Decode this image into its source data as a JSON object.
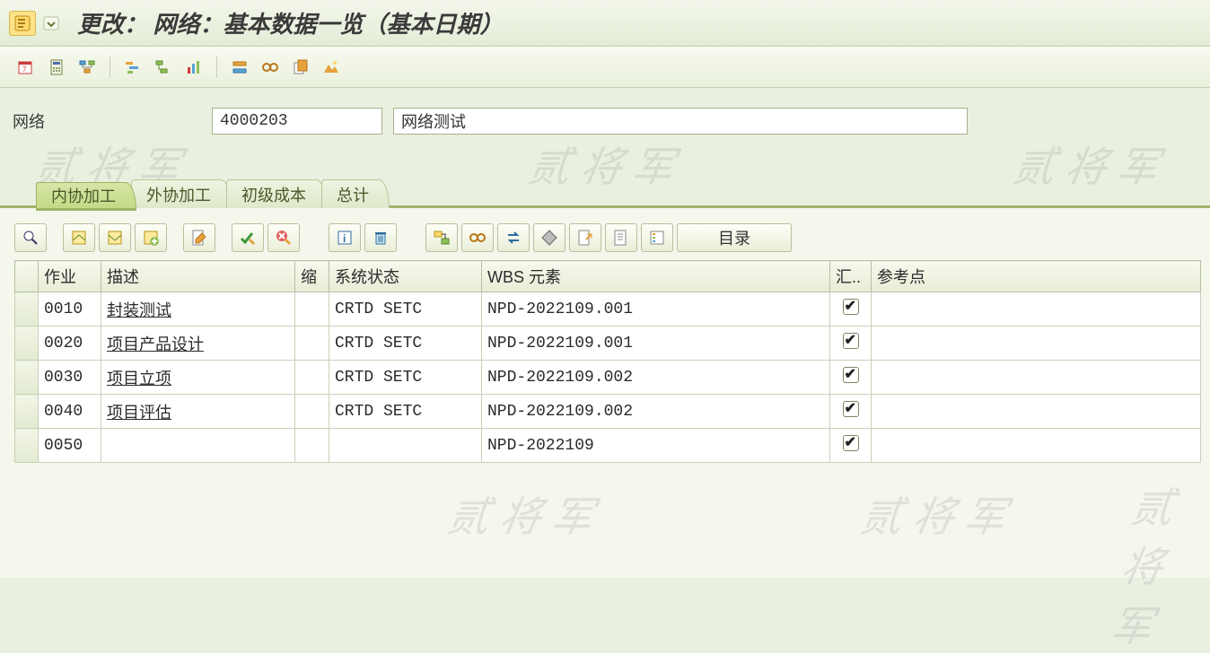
{
  "title": "更改： 网络：基本数据一览（基本日期）",
  "network": {
    "label": "网络",
    "id": "4000203",
    "desc": "网络测试"
  },
  "tabs": [
    {
      "label": "内协加工",
      "active": true
    },
    {
      "label": "外协加工",
      "active": false
    },
    {
      "label": "初级成本",
      "active": false
    },
    {
      "label": "总计",
      "active": false
    }
  ],
  "grid_toolbar": {
    "catalog_label": "目录"
  },
  "columns": {
    "sel": "",
    "op": "作业",
    "desc": "描述",
    "short": "缩",
    "status": "系统状态",
    "wbs": "WBS 元素",
    "agg": "汇..",
    "refpt": "参考点"
  },
  "rows": [
    {
      "op": "0010",
      "desc": "封装测试",
      "status": "CRTD SETC",
      "wbs": "NPD-2022109.001",
      "agg": true
    },
    {
      "op": "0020",
      "desc": "项目产品设计",
      "status": "CRTD SETC",
      "wbs": "NPD-2022109.001",
      "agg": true
    },
    {
      "op": "0030",
      "desc": "项目立项",
      "status": "CRTD SETC",
      "wbs": "NPD-2022109.002",
      "agg": true
    },
    {
      "op": "0040",
      "desc": "项目评估",
      "status": "CRTD SETC",
      "wbs": "NPD-2022109.002",
      "agg": true
    },
    {
      "op": "0050",
      "desc": "",
      "status": "",
      "wbs": "NPD-2022109",
      "agg": true
    }
  ],
  "watermark": "贰 将 军"
}
